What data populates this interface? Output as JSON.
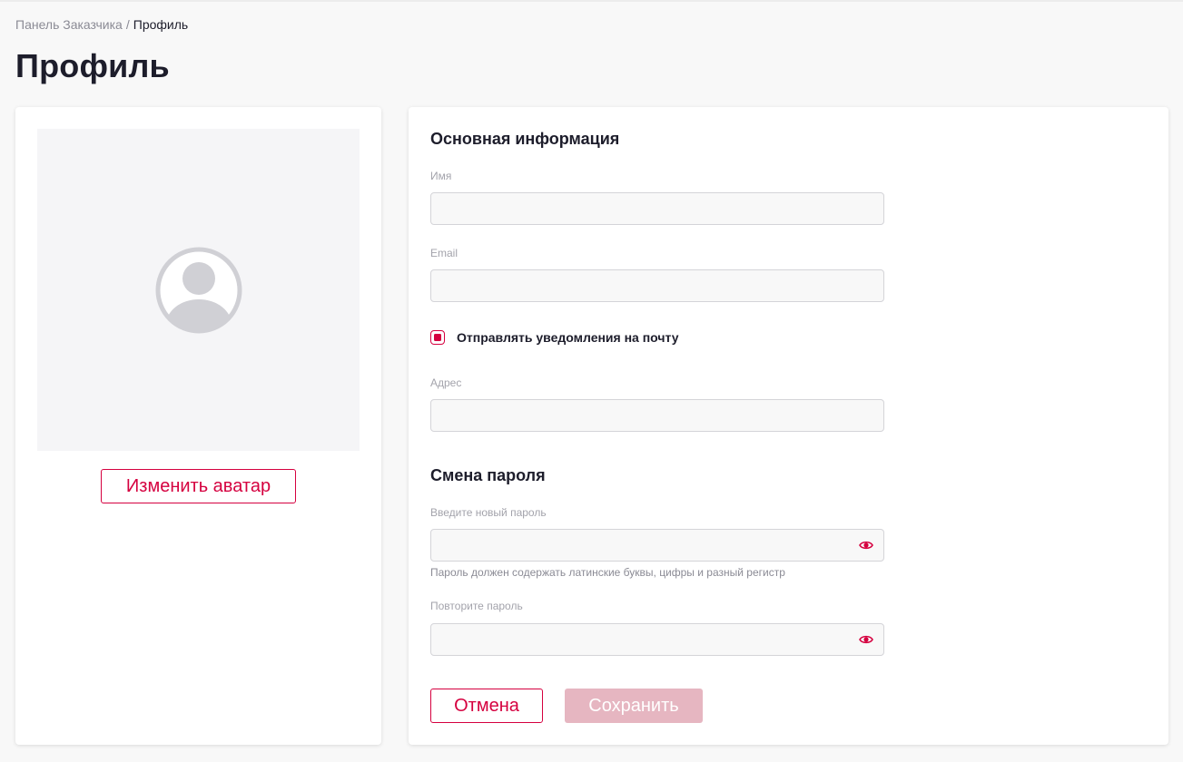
{
  "breadcrumb": {
    "parent": "Панель Заказчика",
    "separator": "/",
    "current": "Профиль"
  },
  "page": {
    "title": "Профиль"
  },
  "avatar": {
    "icon": "user-avatar-icon",
    "change_button": "Изменить аватар"
  },
  "basic_info": {
    "title": "Основная информация",
    "name_label": "Имя",
    "name_value": "",
    "email_label": "Email",
    "email_value": "",
    "notify_label": "Отправлять уведомления на почту",
    "notify_checked": true,
    "address_label": "Адрес",
    "address_value": ""
  },
  "password": {
    "title": "Смена пароля",
    "new_label": "Введите новый пароль",
    "new_value": "",
    "hint": "Пароль должен содержать латинские буквы, цифры и разный регистр",
    "repeat_label": "Повторите пароль",
    "repeat_value": "",
    "visibility_icon": "eye-icon"
  },
  "actions": {
    "cancel": "Отмена",
    "save": "Сохранить",
    "save_disabled": true
  },
  "colors": {
    "accent": "#d5003f",
    "accent_disabled": "#e6b6c1",
    "background": "#f8f8f8",
    "card": "#ffffff",
    "avatar_placeholder": "#d0d0d5"
  }
}
